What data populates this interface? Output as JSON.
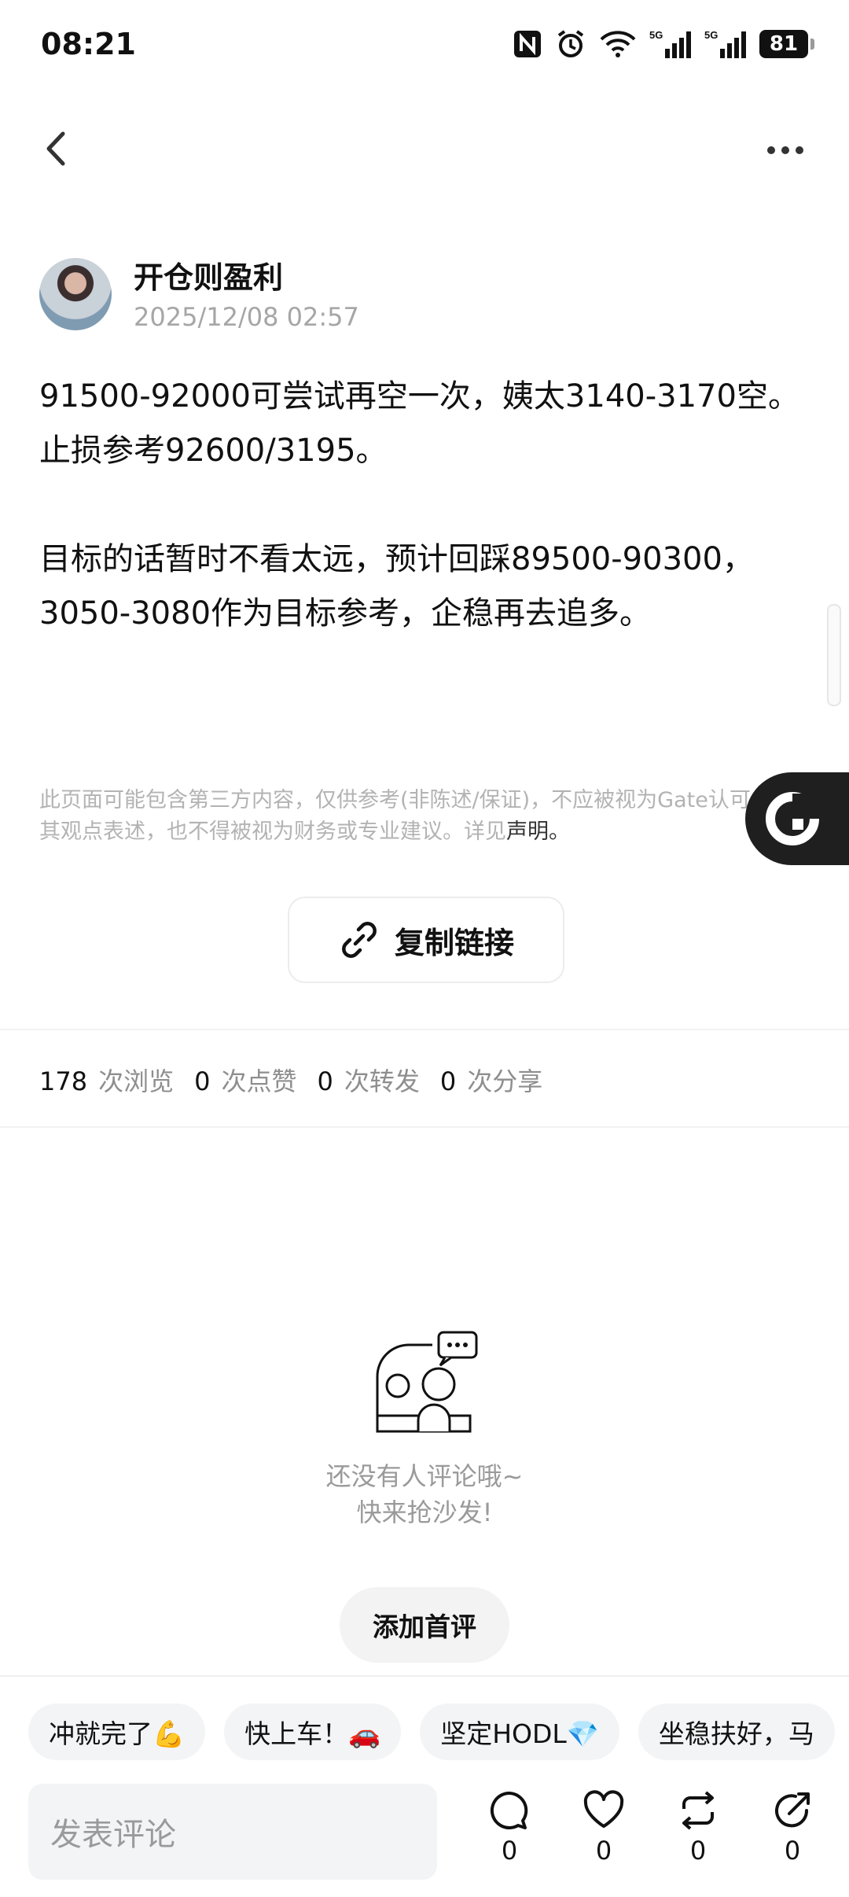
{
  "status_bar": {
    "time": "08:21",
    "battery": "81",
    "network1": "5G",
    "network2": "5G"
  },
  "post": {
    "author": "开仓则盈利",
    "timestamp": "2025/12/08 02:57",
    "paragraphs": [
      "91500-92000可尝试再空一次，姨太3140-3170空。",
      "止损参考92600/3195。",
      "",
      "目标的话暂时不看太远，预计回踩89500-90300，3050-3080作为目标参考，企稳再去追多。"
    ],
    "disclaimer": "此页面可能包含第三方内容，仅供参考(非陈述/保证)，不应被视为Gate认可其观点表述，也不得被视为财务或专业建议。详见",
    "disclaimer_link": "声明。"
  },
  "copy_link_label": "复制链接",
  "stats": {
    "views": "178",
    "views_label": "次浏览",
    "likes": "0",
    "likes_label": "次点赞",
    "reposts": "0",
    "reposts_label": "次转发",
    "shares": "0",
    "shares_label": "次分享"
  },
  "comments": {
    "empty_line1": "还没有人评论哦~",
    "empty_line2": "快来抢沙发!",
    "add_first_label": "添加首评"
  },
  "quick_replies": [
    "冲就完了💪",
    "快上车！🚗",
    "坚定HODL💎",
    "坐稳扶好，马"
  ],
  "bottom_bar": {
    "input_placeholder": "发表评论",
    "comment_count": "0",
    "like_count": "0",
    "repost_count": "0",
    "share_count": "0"
  }
}
